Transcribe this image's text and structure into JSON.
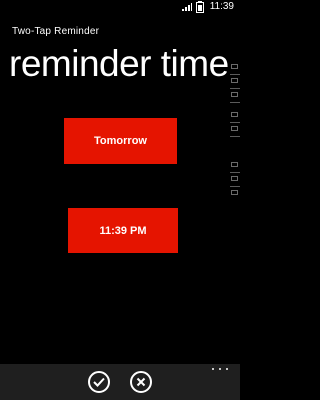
{
  "status_bar": {
    "time": "11:39",
    "icons": [
      "signal-icon",
      "battery-icon"
    ]
  },
  "app": {
    "title": "Two-Tap Reminder",
    "page_title": "reminder time"
  },
  "main": {
    "date_button_label": "Tomorrow",
    "time_button_label": "11:39 PM"
  },
  "colors": {
    "accent": "#e51400",
    "background": "#000000",
    "app_bar": "#1f1f1f"
  },
  "app_bar": {
    "buttons": [
      "check-icon",
      "cancel-icon"
    ],
    "more_menu": "ellipsis-icon"
  }
}
